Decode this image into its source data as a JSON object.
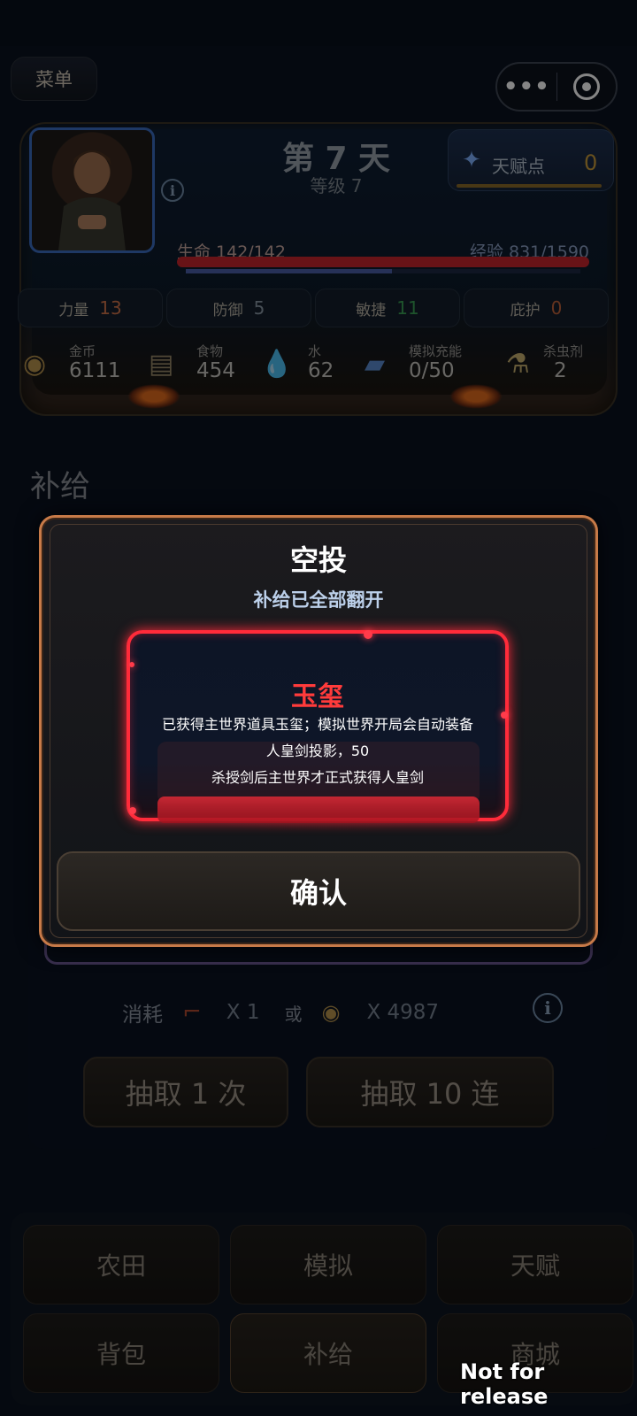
{
  "menu_label": "菜单",
  "capsule": {
    "more_icon": "more-dots-icon",
    "close_icon": "target-icon"
  },
  "header": {
    "day": "第 7 天",
    "level": "等级 7",
    "talent_label": "天赋点",
    "talent_value": "0",
    "hp": "生命 142/142",
    "xp": "经验 831/1590",
    "hp_fraction": 1.0,
    "xp_fraction": 0.523
  },
  "stats": [
    {
      "label": "力量",
      "value": "13",
      "color": "#d0734a"
    },
    {
      "label": "防御",
      "value": "5",
      "color": "#8a98a6"
    },
    {
      "label": "敏捷",
      "value": "11",
      "color": "#3aa055"
    },
    {
      "label": "庇护",
      "value": "0",
      "color": "#c0623a"
    }
  ],
  "resources": [
    {
      "label": "金币",
      "value": "6111",
      "icon": "coins-icon"
    },
    {
      "label": "食物",
      "value": "454",
      "icon": "food-icon"
    },
    {
      "label": "水",
      "value": "62",
      "icon": "water-icon"
    },
    {
      "label": "模拟充能",
      "value": "0/50",
      "icon": "battery-icon"
    },
    {
      "label": "杀虫剂",
      "value": "2",
      "icon": "spray-icon"
    }
  ],
  "section_title": "补给",
  "cost": {
    "label": "消耗",
    "qty1": "X 1",
    "or": "或",
    "qty2": "X 4987"
  },
  "draw_buttons": {
    "once": "抽取 1 次",
    "ten": "抽取 10 连"
  },
  "nav": [
    {
      "label": "农田",
      "active": false
    },
    {
      "label": "模拟",
      "active": false
    },
    {
      "label": "天赋",
      "active": false
    },
    {
      "label": "背包",
      "active": false
    },
    {
      "label": "补给",
      "active": true
    },
    {
      "label": "商城",
      "active": false
    }
  ],
  "modal": {
    "title": "空投",
    "subtitle": "补给已全部翻开",
    "item_name": "玉玺",
    "desc_line1": "已获得主世界道具玉玺；模拟世界开局会自动装备",
    "desc_line2": "人皇剑投影，50",
    "desc_line3": "杀授剑后主世界才正式获得人皇剑",
    "confirm": "确认"
  },
  "watermark": "Not for release"
}
